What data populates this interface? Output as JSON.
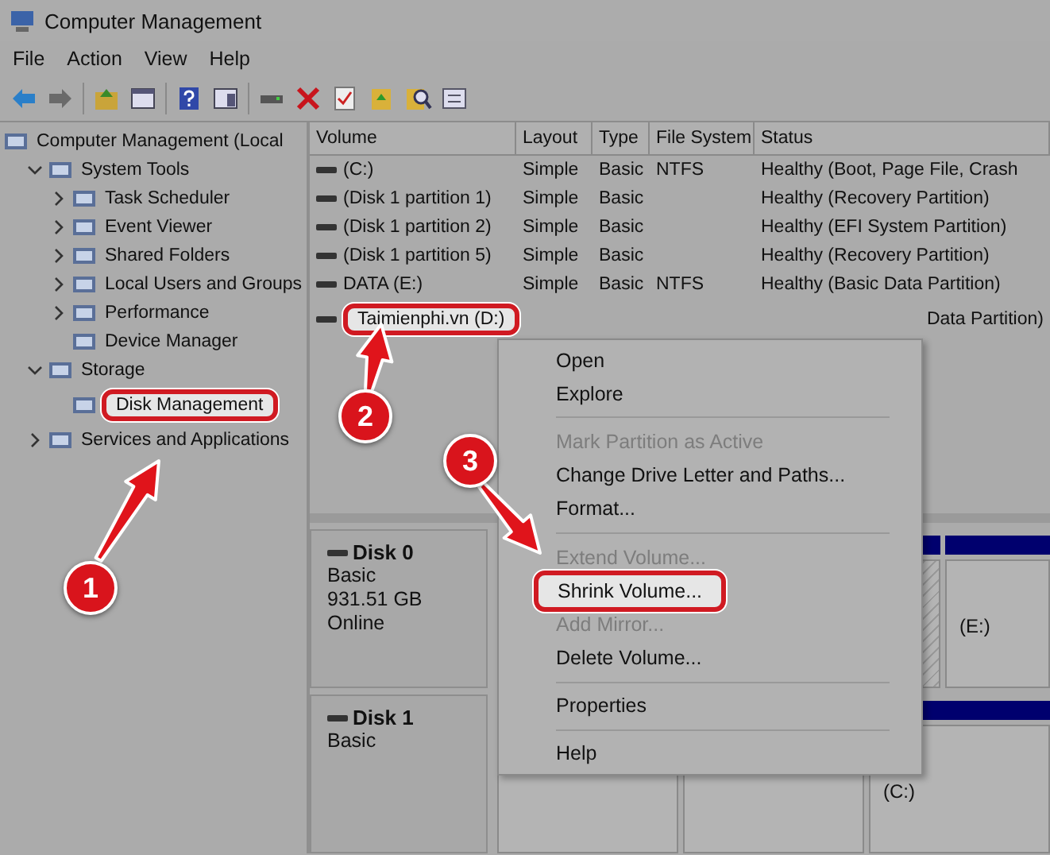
{
  "window": {
    "title": "Computer Management"
  },
  "menu": [
    "File",
    "Action",
    "View",
    "Help"
  ],
  "tree": [
    {
      "label": "Computer Management (Local",
      "highlighted": false,
      "children": [
        {
          "label": "System Tools",
          "expanded": true,
          "highlighted": false,
          "children": [
            {
              "label": "Task Scheduler",
              "expanded": false,
              "highlighted": false
            },
            {
              "label": "Event Viewer",
              "expanded": false,
              "highlighted": false
            },
            {
              "label": "Shared Folders",
              "expanded": false,
              "highlighted": false
            },
            {
              "label": "Local Users and Groups",
              "expanded": false,
              "highlighted": false
            },
            {
              "label": "Performance",
              "expanded": false,
              "highlighted": false
            },
            {
              "label": "Device Manager",
              "highlighted": false
            }
          ]
        },
        {
          "label": "Storage",
          "expanded": true,
          "highlighted": false,
          "children": [
            {
              "label": "Disk Management",
              "highlighted": true
            }
          ]
        },
        {
          "label": "Services and Applications",
          "expanded": false,
          "highlighted": false
        }
      ]
    }
  ],
  "table": {
    "columns": [
      "Volume",
      "Layout",
      "Type",
      "File System",
      "Status"
    ],
    "rows": [
      {
        "cells": [
          "(C:)",
          "Simple",
          "Basic",
          "NTFS",
          "Healthy (Boot, Page File, Crash"
        ],
        "highlighted": false
      },
      {
        "cells": [
          "(Disk 1 partition 1)",
          "Simple",
          "Basic",
          "",
          "Healthy (Recovery Partition)"
        ],
        "highlighted": false
      },
      {
        "cells": [
          "(Disk 1 partition 2)",
          "Simple",
          "Basic",
          "",
          "Healthy (EFI System Partition)"
        ],
        "highlighted": false
      },
      {
        "cells": [
          "(Disk 1 partition 5)",
          "Simple",
          "Basic",
          "",
          "Healthy (Recovery Partition)"
        ],
        "highlighted": false
      },
      {
        "cells": [
          "DATA (E:)",
          "Simple",
          "Basic",
          "NTFS",
          "Healthy (Basic Data Partition)"
        ],
        "highlighted": false
      },
      {
        "cells": [
          "Taimienphi.vn (D:)",
          "",
          "",
          "",
          "Data Partition)"
        ],
        "highlighted": true
      }
    ]
  },
  "disks": [
    {
      "name": "Disk 0",
      "lines": [
        "Basic",
        "931.51 GB",
        "Online"
      ],
      "partitions": [
        {
          "hatched": true
        },
        {
          "label": "(E:)",
          "hatched": false
        }
      ]
    },
    {
      "name": "Disk 1",
      "lines": [
        "Basic"
      ],
      "partitions": [
        {
          "hatched": false
        },
        {
          "hatched": false
        },
        {
          "label": "(C:)",
          "hatched": false
        }
      ]
    }
  ],
  "context_menu": [
    {
      "kind": "item",
      "label": "Open",
      "disabled": false,
      "highlighted": false
    },
    {
      "kind": "item",
      "label": "Explore",
      "disabled": false,
      "highlighted": false
    },
    {
      "kind": "separator"
    },
    {
      "kind": "item",
      "label": "Mark Partition as Active",
      "disabled": true,
      "highlighted": false
    },
    {
      "kind": "item",
      "label": "Change Drive Letter and Paths...",
      "disabled": false,
      "highlighted": false
    },
    {
      "kind": "item",
      "label": "Format...",
      "disabled": false,
      "highlighted": false
    },
    {
      "kind": "separator"
    },
    {
      "kind": "item",
      "label": "Extend Volume...",
      "disabled": true,
      "highlighted": false
    },
    {
      "kind": "item",
      "label": "Shrink Volume...",
      "disabled": false,
      "highlighted": true
    },
    {
      "kind": "item",
      "label": "Add Mirror...",
      "disabled": true,
      "highlighted": false
    },
    {
      "kind": "item",
      "label": "Delete Volume...",
      "disabled": false,
      "highlighted": false
    },
    {
      "kind": "separator"
    },
    {
      "kind": "item",
      "label": "Properties",
      "disabled": false,
      "highlighted": false
    },
    {
      "kind": "separator"
    },
    {
      "kind": "item",
      "label": "Help",
      "disabled": false,
      "highlighted": false
    }
  ],
  "annotations": [
    {
      "number": "1"
    },
    {
      "number": "2"
    },
    {
      "number": "3"
    }
  ]
}
